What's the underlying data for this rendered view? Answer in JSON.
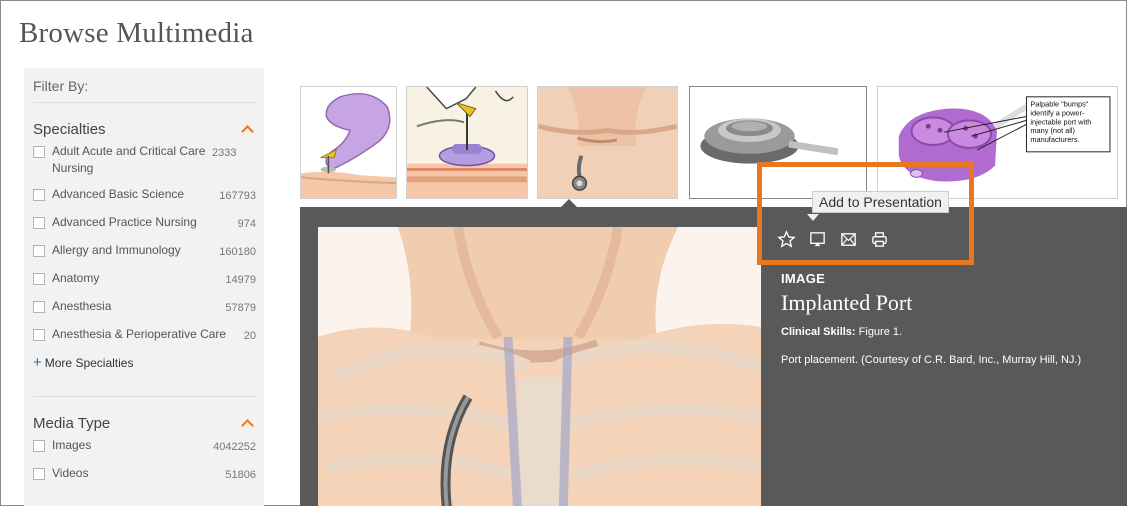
{
  "page": {
    "title": "Browse Multimedia"
  },
  "sidebar": {
    "filter_by": "Filter By:",
    "specialties": {
      "heading": "Specialties",
      "items": [
        {
          "label": "Adult Acute and Critical Care Nursing",
          "count": "2333"
        },
        {
          "label": "Advanced Basic Science",
          "count": "167793"
        },
        {
          "label": "Advanced Practice Nursing",
          "count": "974"
        },
        {
          "label": "Allergy and Immunology",
          "count": "160180"
        },
        {
          "label": "Anatomy",
          "count": "14979"
        },
        {
          "label": "Anesthesia",
          "count": "57879"
        },
        {
          "label": "Anesthesia & Perioperative Care",
          "count": "20"
        }
      ],
      "more_label": "More Specialties"
    },
    "media_type": {
      "heading": "Media Type",
      "items": [
        {
          "label": "Images",
          "count": "4042252"
        },
        {
          "label": "Videos",
          "count": "51806"
        }
      ]
    }
  },
  "thumbnails": {
    "labels": {
      "callout": [
        "Palpable \"bumps\"",
        "identify a power-",
        "injectable port with",
        "many (not all)",
        "manufacturers."
      ]
    }
  },
  "viewer": {
    "tooltip": "Add to Presentation",
    "actions": [
      "star-icon",
      "presentation-icon",
      "email-icon",
      "print-icon"
    ],
    "type_label": "IMAGE",
    "title": "Implanted Port",
    "caption_source": "Clinical Skills:",
    "caption_figure": "Figure 1.",
    "credit": "Port placement. (Courtesy of C.R. Bard, Inc., Murray Hill, NJ.)"
  },
  "colors": {
    "accent": "#e87722",
    "viewer_bg": "#595959",
    "sidebar_bg": "#f2f2f2"
  }
}
